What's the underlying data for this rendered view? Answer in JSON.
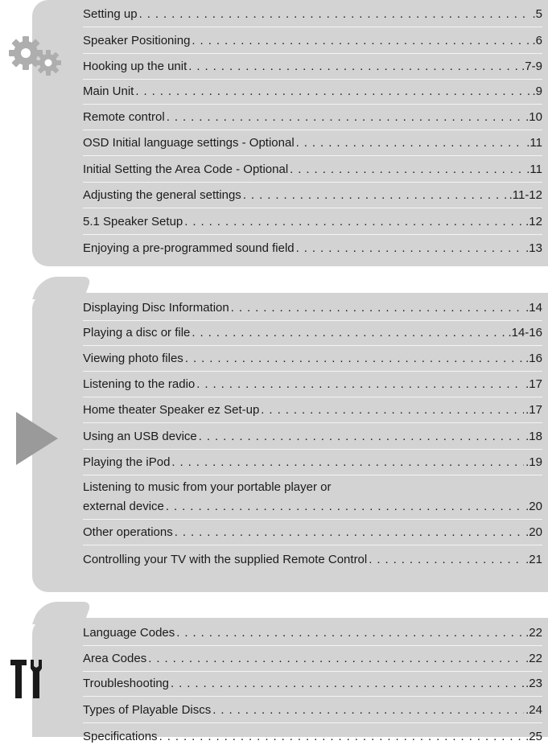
{
  "sections": [
    {
      "icon": "gears-icon",
      "entries": [
        {
          "title": "Setting up",
          "page": ".5"
        },
        {
          "title": "Speaker Positioning",
          "page": ".6"
        },
        {
          "title": "Hooking up the unit",
          "page": ".7-9"
        },
        {
          "title": "Main Unit",
          "page": ".9"
        },
        {
          "title": "Remote control",
          "page": ".10"
        },
        {
          "title": "OSD Initial language settings - Optional",
          "page": ".11"
        },
        {
          "title": "Initial Setting the Area Code - Optional",
          "page": ".11"
        },
        {
          "title": "Adjusting the general settings",
          "page": ".11-12"
        },
        {
          "title": "5.1 Speaker Setup",
          "page": ".12"
        },
        {
          "title": "Enjoying a pre-programmed sound field",
          "page": ".13"
        }
      ]
    },
    {
      "icon": "play-icon",
      "entries": [
        {
          "title": "Displaying Disc Information",
          "page": ".14"
        },
        {
          "title": "Playing a disc or file",
          "page": ".14-16"
        },
        {
          "title": "Viewing photo files",
          "page": ".16"
        },
        {
          "title": "Listening to the radio",
          "page": ".17"
        },
        {
          "title": "Home theater Speaker ez Set-up",
          "page": ".17"
        },
        {
          "title": "Using an USB device",
          "page": ".18"
        },
        {
          "title": "Playing the iPod",
          "page": ".19"
        },
        {
          "title": "Listening to music from your portable player or",
          "title2": "external device",
          "page": ".20"
        },
        {
          "title": "Other operations",
          "page": ".20"
        },
        {
          "title": "Controlling your TV with the supplied Remote Control",
          "page": ".21"
        }
      ]
    },
    {
      "icon": "tools-icon",
      "entries": [
        {
          "title": "Language Codes",
          "page": ".22"
        },
        {
          "title": "Area Codes",
          "page": ".22"
        },
        {
          "title": "Troubleshooting",
          "page": ".23"
        },
        {
          "title": "Types of Playable Discs",
          "page": ".24"
        },
        {
          "title": "Specifications",
          "page": ".25"
        }
      ]
    }
  ]
}
